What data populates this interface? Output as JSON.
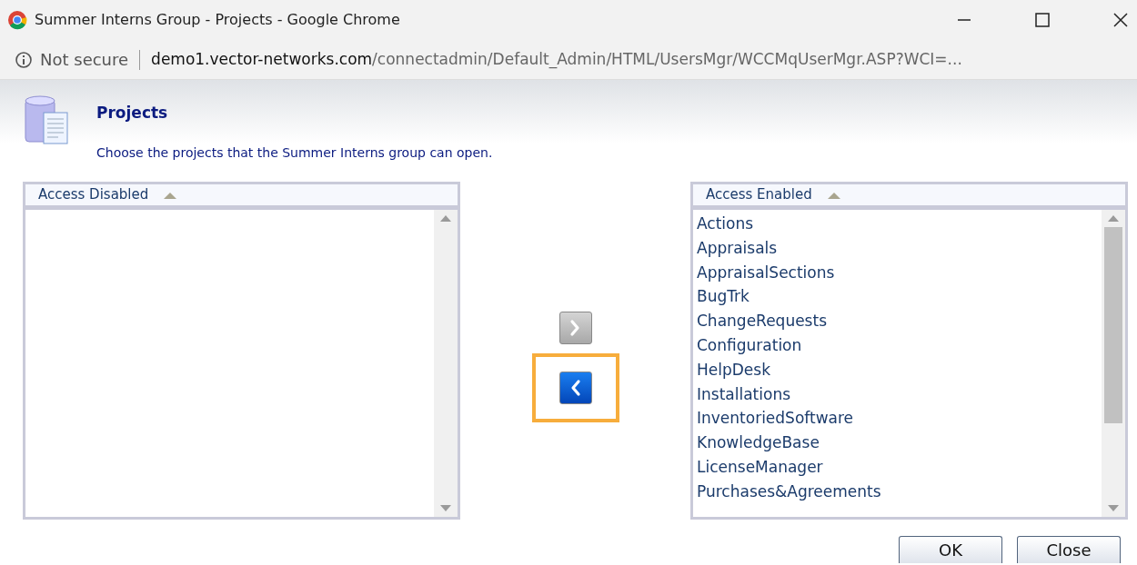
{
  "window": {
    "title": "Summer Interns Group - Projects - Google Chrome"
  },
  "address_bar": {
    "security": "Not secure",
    "domain": "demo1.vector-networks.com",
    "path": "/connectadmin/Default_Admin/HTML/UsersMgr/WCCMqUserMgr.ASP?WCI=..."
  },
  "header": {
    "title": "Projects",
    "description": "Choose the projects that the Summer Interns group can open."
  },
  "lists": [
    {
      "heading": "Access Disabled",
      "sorted_ascending": true
    },
    {
      "heading": "Access Enabled",
      "sorted_ascending": true,
      "items": [
        "Actions",
        "Appraisals",
        "AppraisalSections",
        "BugTrk",
        "ChangeRequests",
        "Configuration",
        "HelpDesk",
        "Installations",
        "InventoriedSoftware",
        "KnowledgeBase",
        "LicenseManager",
        "Purchases&Agreements"
      ]
    }
  ],
  "move_buttons": [
    {
      "kind": "add",
      "disabled": true,
      "highlighted": false
    },
    {
      "kind": "remove",
      "disabled": false,
      "highlighted": true
    }
  ],
  "buttons": [
    "OK",
    "Close"
  ]
}
